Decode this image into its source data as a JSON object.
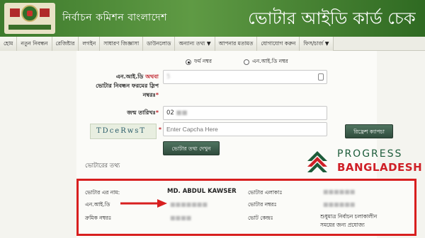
{
  "header": {
    "commission_name": "নির্বাচন কমিশন বাংলাদেশ",
    "page_title": "ভোটার আইডি কার্ড চেক",
    "brand_color": "#4a8a34"
  },
  "nav": {
    "items": [
      "হোম",
      "নতুন নিবন্ধন",
      "রেজিষ্টার",
      "লগইন",
      "সাধারণ জিজ্ঞাসা",
      "ডাউনলোড",
      "অন্যান্য তথ্য ▼",
      "আপনার মতামত",
      "যোগাযোগ করুন",
      "ফিস/চার্জ ▼"
    ]
  },
  "form": {
    "radio_form_no": "ফর্ম নম্বর",
    "radio_nid_no": "এন.আই.ডি নম্বর",
    "nid_label_part1": "এন.আই.ডি",
    "nid_label_or": "অথবা",
    "nid_label_part2": "ভোটার নিবন্ধন ফরমের স্লিপ নম্বরঃ",
    "nid_value": "5",
    "dob_label": "জন্ম তারিখঃ",
    "dob_value": "02",
    "captcha_text": "TDceRwsT",
    "captcha_placeholder": "Enter Capcha Here",
    "refresh_captcha": "রিফ্রেশ ক্যাপচা",
    "submit_button": "ভোটার তথ্য দেখুন",
    "section_title": "ভোটারের তথ্য"
  },
  "logo": {
    "line1": "PROGRESS",
    "line2": "BANGLADESH",
    "green": "#1d5c3a",
    "red": "#cf2027"
  },
  "result": {
    "name_label": "ভোটার এর নাম:",
    "name_value": "MD. ABDUL KAWSER",
    "nid_label": "এন.আই.ডি",
    "serial_label": "ক্রমিক নম্বরঃ",
    "area_label": "ভোটার এলাকাঃ",
    "voter_no_label": "ভোটার নম্বরঃ",
    "center_label": "ভোট কেন্দ্রঃ",
    "center_value_line1": "শুধুমাত্র নির্বাচন চলাকালীন",
    "center_value_line2": "সময়ের জন্য প্রযোজ্য",
    "highlight_color": "#d81f1f"
  }
}
